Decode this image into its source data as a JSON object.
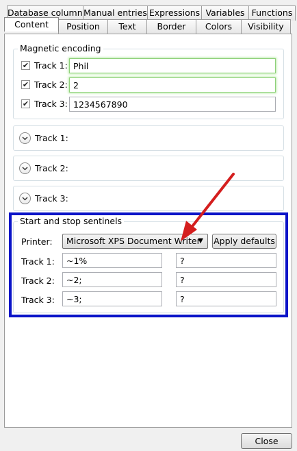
{
  "tabs_back": [
    "Database columns",
    "Manual entries",
    "Expressions",
    "Variables",
    "Functions"
  ],
  "tabs_front": [
    "Content",
    "Position",
    "Text",
    "Border",
    "Colors",
    "Visibility"
  ],
  "magnetic": {
    "legend": "Magnetic encoding",
    "tracks": [
      {
        "label": "Track 1:",
        "value": "Phil",
        "checked": true
      },
      {
        "label": "Track 2:",
        "value": "2",
        "checked": true
      },
      {
        "label": "Track 3:",
        "value": "1234567890",
        "checked": true
      }
    ]
  },
  "expanders": [
    "Track 1:",
    "Track 2:",
    "Track 3:"
  ],
  "sentinels": {
    "legend": "Start and stop sentinels",
    "printer_label": "Printer:",
    "printer_value": "Microsoft XPS Document Writer",
    "apply_defaults": "Apply defaults",
    "rows": [
      {
        "label": "Track 1:",
        "start": "~1%",
        "stop": "?"
      },
      {
        "label": "Track 2:",
        "start": "~2;",
        "stop": "?"
      },
      {
        "label": "Track 3:",
        "start": "~3;",
        "stop": "?"
      }
    ]
  },
  "close_label": "Close",
  "colors": {
    "highlight_box": "#0a14c8",
    "annotation_arrow": "#d41e1e",
    "focus_glow": "#8fd07a"
  }
}
